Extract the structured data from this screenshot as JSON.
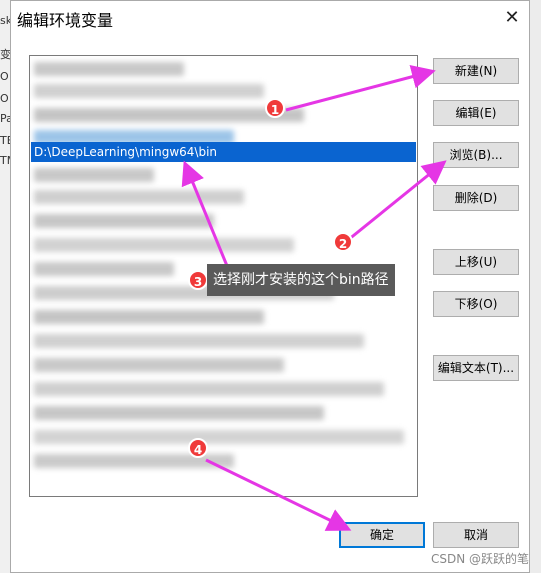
{
  "background_left_fragments": [
    "sk",
    "变",
    "O",
    "O",
    "Pa",
    "TE",
    "TM"
  ],
  "dialog": {
    "title": "编辑环境变量",
    "close_glyph": "✕"
  },
  "list": {
    "selected_value": "D:\\DeepLearning\\mingw64\\bin"
  },
  "buttons": {
    "new": "新建(N)",
    "edit": "编辑(E)",
    "browse": "浏览(B)...",
    "delete": "删除(D)",
    "move_up": "上移(U)",
    "move_down": "下移(O)",
    "edit_text": "编辑文本(T)...",
    "ok": "确定",
    "cancel": "取消"
  },
  "annotations": {
    "badges": [
      "1",
      "2",
      "3",
      "4"
    ],
    "tooltip": "选择刚才安装的这个bin路径",
    "arrow_color": "#e536e5",
    "badge_color": "#f03a3a"
  },
  "selection_color": "#0a64d0",
  "watermark": "CSDN @跃跃的笔"
}
